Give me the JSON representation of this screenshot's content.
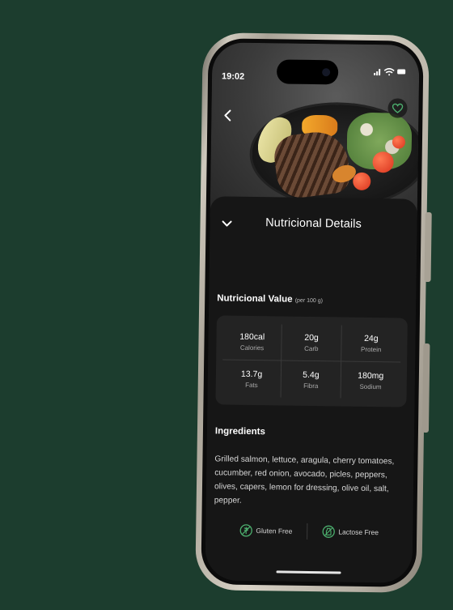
{
  "status": {
    "time": "19:02"
  },
  "hero": {
    "image": "salmon-bowl-photo"
  },
  "sheet": {
    "title": "Nutricional Details"
  },
  "nutrition": {
    "title": "Nutricional Value",
    "unit_note": "(per 100 g)",
    "items": [
      {
        "value": "180cal",
        "label": "Calories"
      },
      {
        "value": "20g",
        "label": "Carb"
      },
      {
        "value": "24g",
        "label": "Protein"
      },
      {
        "value": "13.7g",
        "label": "Fats"
      },
      {
        "value": "5.4g",
        "label": "Fibra"
      },
      {
        "value": "180mg",
        "label": "Sodium"
      }
    ]
  },
  "ingredients": {
    "title": "Ingredients",
    "text": "Grilled salmon, lettuce, aragula, cherry tomatoes, cucumber, red onion, avocado, picles, peppers, olives, capers, lemon for dressing, olive oil, salt, pepper."
  },
  "tags": [
    {
      "label": "Gluten Free",
      "icon": "gluten-free-icon"
    },
    {
      "label": "Lactose Free",
      "icon": "lactose-free-icon"
    }
  ],
  "colors": {
    "background": "#1c3d2e",
    "accent": "#4caf6e",
    "sheet": "#161616",
    "card": "#232323"
  }
}
